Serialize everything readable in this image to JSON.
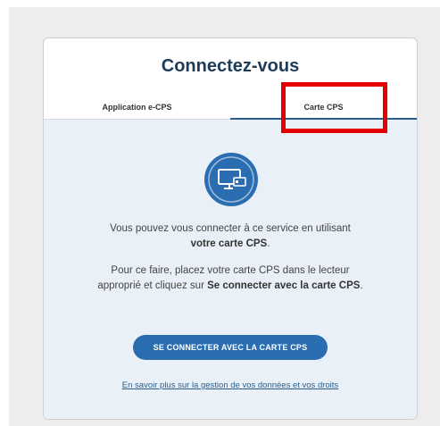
{
  "card": {
    "title": "Connectez-vous",
    "tabs": [
      {
        "label": "Application e-CPS",
        "active": false
      },
      {
        "label": "Carte CPS",
        "active": true
      }
    ]
  },
  "panel": {
    "icon": "computer-card-reader-icon",
    "paragraph1": {
      "text": "Vous pouvez vous connecter à ce service en utilisant ",
      "bold": "votre carte CPS",
      "end": "."
    },
    "paragraph2": {
      "text": "Pour ce faire, placez votre carte CPS dans le lecteur approprié et cliquez sur ",
      "bold": "Se connecter avec la carte CPS",
      "end": "."
    },
    "button_label": "SE CONNECTER AVEC LA CARTE CPS",
    "info_link": "En savoir plus sur la gestion de vos données et vos droits"
  },
  "colors": {
    "accent": "#2a6db1",
    "title": "#1f3b57",
    "panel_bg": "#eaf0f7",
    "highlight": "#e30000"
  }
}
